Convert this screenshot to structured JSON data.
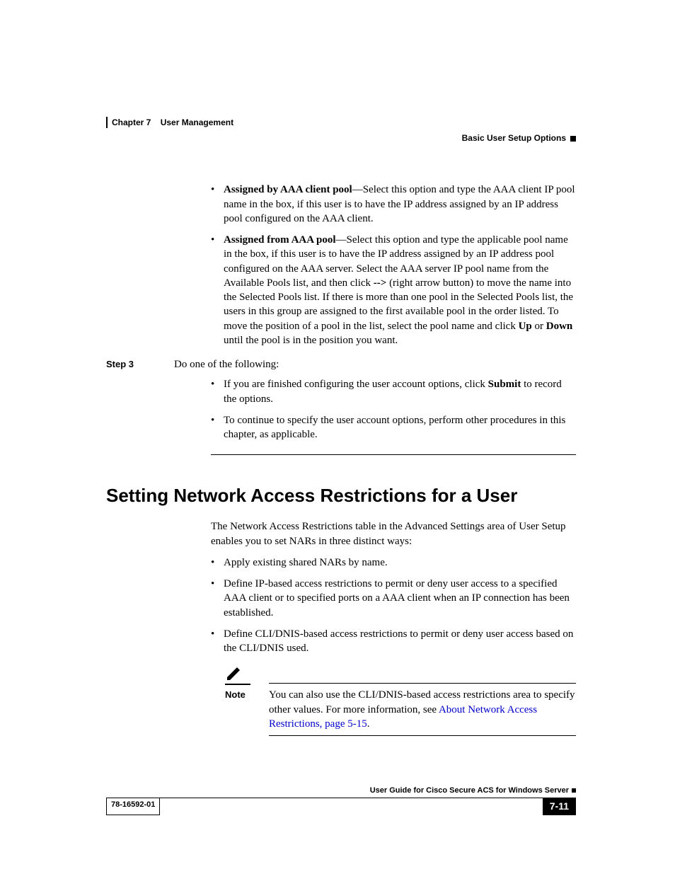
{
  "header": {
    "chapter_label": "Chapter 7",
    "chapter_title": "User Management",
    "section_right": "Basic User Setup Options"
  },
  "body": {
    "bullet_a_bold": "Assigned by AAA client pool",
    "bullet_a_rest": "—Select this option and type the AAA client IP pool name in the box, if this user is to have the IP address assigned by an IP address pool configured on the AAA client.",
    "bullet_b_bold": "Assigned from AAA pool",
    "bullet_b_rest_1": "—Select this option and type the applicable pool name in the box, if this user is to have the IP address assigned by an IP address pool configured on the AAA server. Select the AAA server IP pool name from the Available Pools list, and then click ",
    "bullet_b_arrow": "-->",
    "bullet_b_rest_2": " (right arrow button) to move the name into the Selected Pools list. If there is more than one pool in the Selected Pools list, the users in this group are assigned to the first available pool in the order listed. To move the position of a pool in the list, select the pool name and click ",
    "bullet_b_up": "Up",
    "bullet_b_or": " or ",
    "bullet_b_down": "Down",
    "bullet_b_rest_3": " until the pool is in the position you want.",
    "step3_label": "Step 3",
    "step3_text": "Do one of the following:",
    "step3_sub_a_1": "If you are finished configuring the user account options, click ",
    "step3_sub_a_bold": "Submit",
    "step3_sub_a_2": " to record the options.",
    "step3_sub_b": "To continue to specify the user account options, perform other procedures in this chapter, as applicable.",
    "h2": "Setting Network Access Restrictions for a User",
    "intro": "The Network Access Restrictions table in the Advanced Settings area of User Setup enables you to set NARs in three distinct ways:",
    "nar_a": "Apply existing shared NARs by name.",
    "nar_b": "Define IP-based access restrictions to permit or deny user access to a specified AAA client or to specified ports on a AAA client when an IP connection has been established.",
    "nar_c": "Define CLI/DNIS-based access restrictions to permit or deny user access based on the CLI/DNIS used.",
    "note_label": "Note",
    "note_text_1": "You can also use the CLI/DNIS-based access restrictions area to specify other values. For more information, see ",
    "note_link": "About Network Access Restrictions, page 5-15",
    "note_text_2": "."
  },
  "footer": {
    "guide_title": "User Guide for Cisco Secure ACS for Windows Server",
    "doc_number": "78-16592-01",
    "page_number": "7-11"
  }
}
